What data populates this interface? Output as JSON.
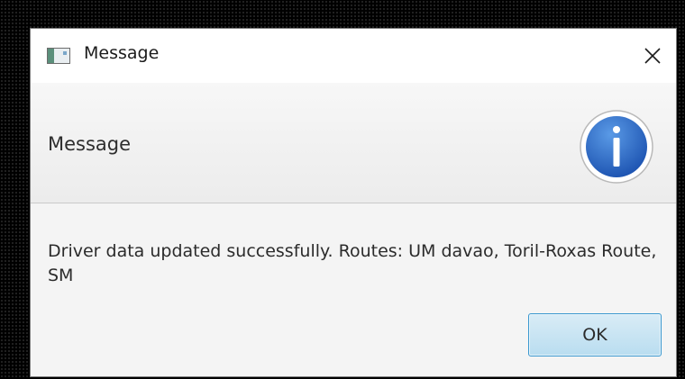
{
  "window": {
    "title": "Message",
    "close_icon": "close-icon",
    "app_icon": "window-app-icon"
  },
  "dialog": {
    "header_text": "Message",
    "header_icon": "info-icon",
    "message": "Driver data updated successfully. Routes: UM davao, Toril-Roxas Route, SM",
    "ok_label": "OK"
  },
  "colors": {
    "info_blue": "#2f6fc7",
    "ok_border": "#3b98cf",
    "ok_fill": "#c8e5f4"
  }
}
